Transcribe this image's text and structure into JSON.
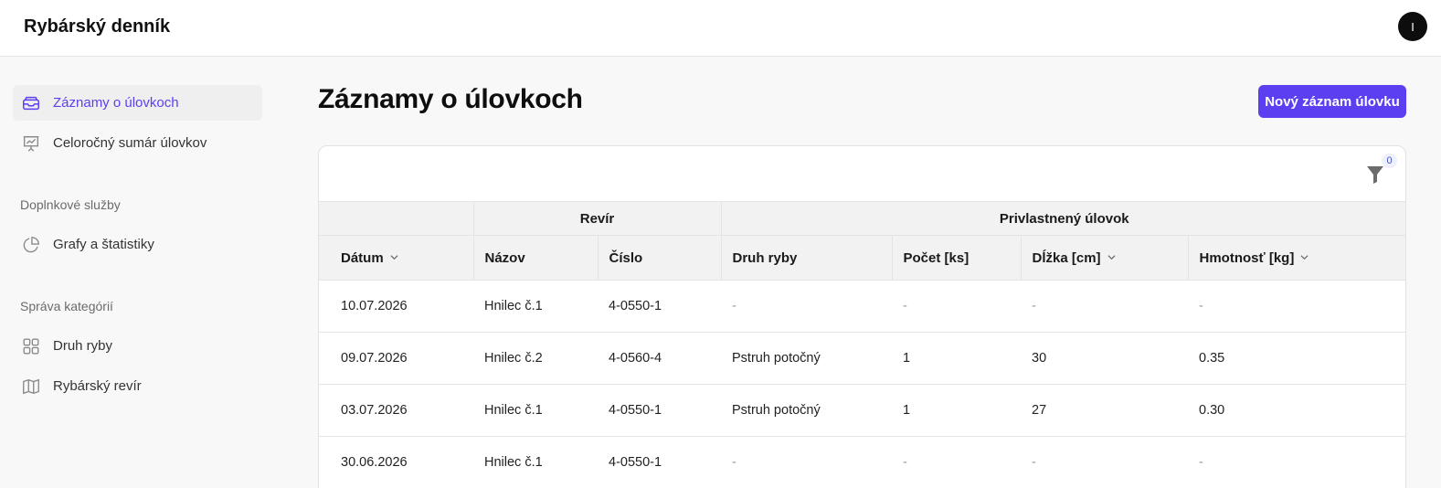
{
  "app": {
    "title": "Rybárský denník",
    "avatar_initial": "I"
  },
  "sidebar": {
    "items": [
      {
        "label": "Záznamy o úlovkoch",
        "icon": "inbox-icon",
        "active": true
      },
      {
        "label": "Celoročný sumár úlovkov",
        "icon": "presentation-chart-icon",
        "active": false
      }
    ],
    "sections": [
      {
        "title": "Doplnkové služby",
        "items": [
          {
            "label": "Grafy a štatistiky",
            "icon": "pie-chart-icon"
          }
        ]
      },
      {
        "title": "Správa kategórií",
        "items": [
          {
            "label": "Druh ryby",
            "icon": "grid-icon"
          },
          {
            "label": "Rybárský revír",
            "icon": "map-icon"
          }
        ]
      }
    ]
  },
  "main": {
    "title": "Záznamy o úlovkoch",
    "new_button": "Nový záznam úlovku",
    "filter_count": "0"
  },
  "table": {
    "groups": {
      "revir": "Revír",
      "catch": "Privlastnený úlovok"
    },
    "columns": [
      "Dátum",
      "Názov",
      "Číslo",
      "Druh ryby",
      "Počet [ks]",
      "Dĺžka [cm]",
      "Hmotnosť [kg]"
    ],
    "rows": [
      [
        "10.07.2026",
        "Hnilec č.1",
        "4-0550-1",
        "-",
        "-",
        "-",
        "-"
      ],
      [
        "09.07.2026",
        "Hnilec č.2",
        "4-0560-4",
        "Pstruh potočný",
        "1",
        "30",
        "0.35"
      ],
      [
        "03.07.2026",
        "Hnilec č.1",
        "4-0550-1",
        "Pstruh potočný",
        "1",
        "27",
        "0.30"
      ],
      [
        "30.06.2026",
        "Hnilec č.1",
        "4-0550-1",
        "-",
        "-",
        "-",
        "-"
      ]
    ]
  },
  "colors": {
    "accent": "#5b3ff0",
    "border": "#e4e4e4",
    "header_bg": "#f2f2f2"
  }
}
